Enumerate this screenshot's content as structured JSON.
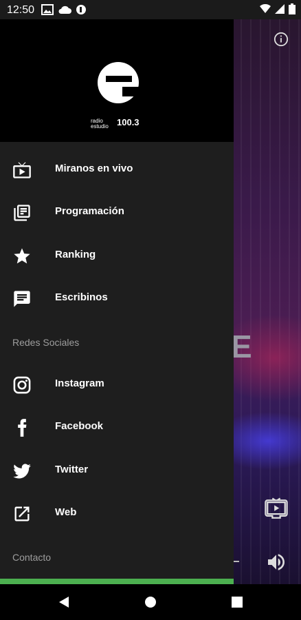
{
  "status_bar": {
    "time": "12:50"
  },
  "brand": {
    "logo_letter": "e",
    "frequency": "100.3",
    "small_line1": "radio",
    "small_line2": "estudio"
  },
  "menu": [
    {
      "label": "Miranos en vivo",
      "icon": "tv-play-icon"
    },
    {
      "label": "Programación",
      "icon": "schedule-list-icon"
    },
    {
      "label": "Ranking",
      "icon": "star-icon"
    },
    {
      "label": "Escribinos",
      "icon": "message-icon"
    }
  ],
  "social_header": "Redes Sociales",
  "social": [
    {
      "label": "Instagram",
      "icon": "instagram-icon"
    },
    {
      "label": "Facebook",
      "icon": "facebook-icon"
    },
    {
      "label": "Twitter",
      "icon": "twitter-icon"
    },
    {
      "label": "Web",
      "icon": "external-link-icon"
    }
  ],
  "contact_header": "Contacto",
  "background": {
    "letter": "E"
  },
  "colors": {
    "accent": "#4caf50",
    "drawer_bg": "#1e1e1e",
    "header_bg": "#000000"
  }
}
